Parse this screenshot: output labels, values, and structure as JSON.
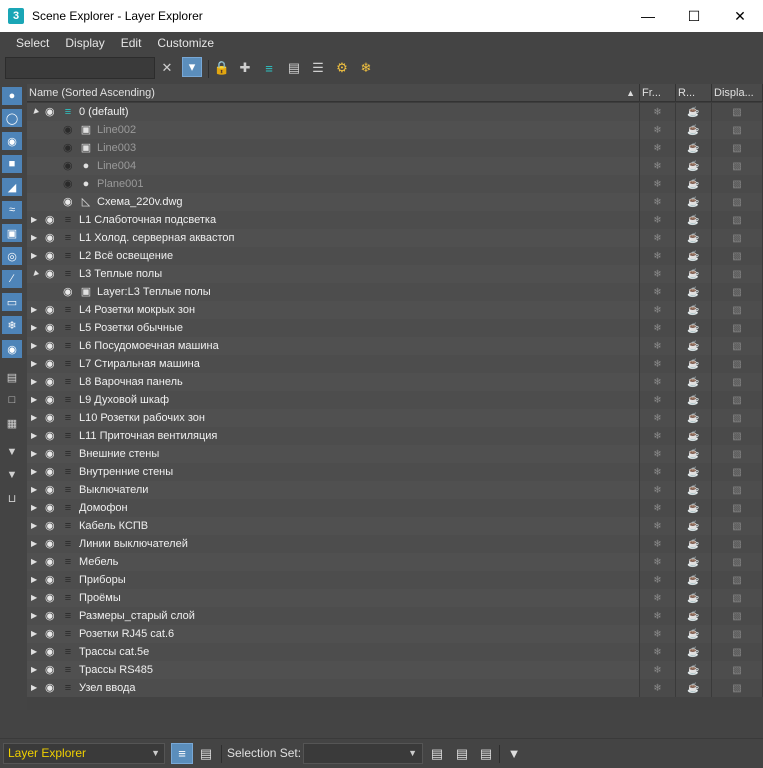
{
  "window": {
    "title": "Scene Explorer - Layer Explorer",
    "app_icon_letter": "3"
  },
  "menu": [
    "Select",
    "Display",
    "Edit",
    "Customize"
  ],
  "toolbar": {
    "search_value": "",
    "icons": [
      "clear-icon",
      "filter-icon",
      "lock-icon",
      "add-layer-icon",
      "layers-icon",
      "hierarchy-icon",
      "layers-stack-icon",
      "layer-props-icon",
      "freeze-icon"
    ]
  },
  "columns": {
    "name": "Name (Sorted Ascending)",
    "frozen": "Fr...",
    "render": "R...",
    "display": "Displa..."
  },
  "rows": [
    {
      "label": "0 (default)",
      "level": 0,
      "expander": "open",
      "type": "layer",
      "active": true
    },
    {
      "label": "Line002",
      "level": 1,
      "expander": "none",
      "type": "shape",
      "hidden": true
    },
    {
      "label": "Line003",
      "level": 1,
      "expander": "none",
      "type": "shape",
      "hidden": true
    },
    {
      "label": "Line004",
      "level": 1,
      "expander": "none",
      "type": "sphere",
      "hidden": true
    },
    {
      "label": "Plane001",
      "level": 1,
      "expander": "none",
      "type": "sphere",
      "hidden": true
    },
    {
      "label": "Схема_220v.dwg",
      "level": 1,
      "expander": "none",
      "type": "dwg"
    },
    {
      "label": "L1 Слаботочная подсветка",
      "level": 0,
      "expander": "closed",
      "type": "layer"
    },
    {
      "label": "L1 Холод. серверная аквастоп",
      "level": 0,
      "expander": "closed",
      "type": "layer"
    },
    {
      "label": "L2 Всё освещение",
      "level": 0,
      "expander": "closed",
      "type": "layer"
    },
    {
      "label": "L3 Теплые полы",
      "level": 0,
      "expander": "open",
      "type": "layer"
    },
    {
      "label": "Layer:L3 Теплые полы",
      "level": 1,
      "expander": "none",
      "type": "shape"
    },
    {
      "label": "L4 Розетки мокрых зон",
      "level": 0,
      "expander": "closed",
      "type": "layer"
    },
    {
      "label": "L5 Розетки обычные",
      "level": 0,
      "expander": "closed",
      "type": "layer"
    },
    {
      "label": "L6 Посудомоечная машина",
      "level": 0,
      "expander": "closed",
      "type": "layer"
    },
    {
      "label": "L7 Стиральная машина",
      "level": 0,
      "expander": "closed",
      "type": "layer"
    },
    {
      "label": "L8 Варочная панель",
      "level": 0,
      "expander": "closed",
      "type": "layer"
    },
    {
      "label": "L9 Духовой шкаф",
      "level": 0,
      "expander": "closed",
      "type": "layer"
    },
    {
      "label": "L10 Розетки рабочих зон",
      "level": 0,
      "expander": "closed",
      "type": "layer"
    },
    {
      "label": "L11 Приточная вентиляция",
      "level": 0,
      "expander": "closed",
      "type": "layer"
    },
    {
      "label": "Внешние стены",
      "level": 0,
      "expander": "closed",
      "type": "layer"
    },
    {
      "label": "Внутренние стены",
      "level": 0,
      "expander": "closed",
      "type": "layer"
    },
    {
      "label": "Выключатели",
      "level": 0,
      "expander": "closed",
      "type": "layer"
    },
    {
      "label": "Домофон",
      "level": 0,
      "expander": "closed",
      "type": "layer"
    },
    {
      "label": "Кабель КСПВ",
      "level": 0,
      "expander": "closed",
      "type": "layer"
    },
    {
      "label": "Линии выключателей",
      "level": 0,
      "expander": "closed",
      "type": "layer"
    },
    {
      "label": "Мебель",
      "level": 0,
      "expander": "closed",
      "type": "layer"
    },
    {
      "label": "Приборы",
      "level": 0,
      "expander": "closed",
      "type": "layer"
    },
    {
      "label": "Проёмы",
      "level": 0,
      "expander": "closed",
      "type": "layer"
    },
    {
      "label": "Размеры_старый слой",
      "level": 0,
      "expander": "closed",
      "type": "layer"
    },
    {
      "label": "Розетки RJ45 cat.6",
      "level": 0,
      "expander": "closed",
      "type": "layer"
    },
    {
      "label": "Трассы cat.5e",
      "level": 0,
      "expander": "closed",
      "type": "layer"
    },
    {
      "label": "Трассы RS485",
      "level": 0,
      "expander": "closed",
      "type": "layer"
    },
    {
      "label": "Узел ввода",
      "level": 0,
      "expander": "closed",
      "type": "layer"
    }
  ],
  "bottom": {
    "explorer_name": "Layer Explorer",
    "selection_set_label": "Selection Set:",
    "selection_set_value": ""
  }
}
